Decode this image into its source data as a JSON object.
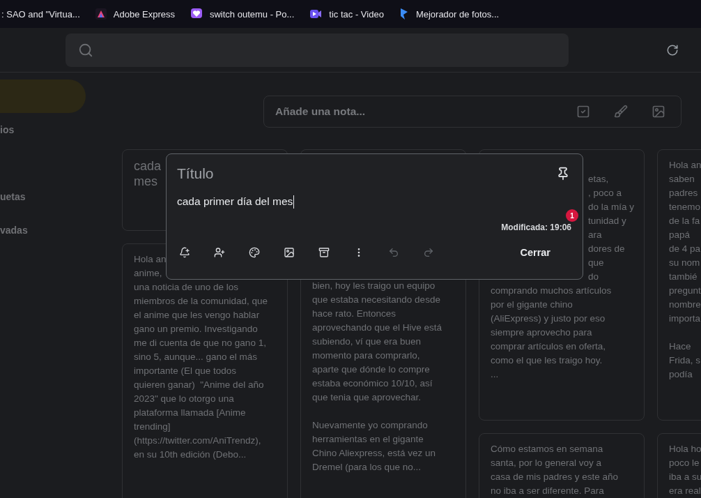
{
  "bookmarks": [
    {
      "label": ": SAO and \"Virtua...",
      "kind": "none"
    },
    {
      "label": "Adobe Express",
      "kind": "adobe"
    },
    {
      "label": "switch outemu - Po...",
      "kind": "heart"
    },
    {
      "label": "tic tac - Video",
      "kind": "video"
    },
    {
      "label": "Mejorador de fotos...",
      "kind": "spark"
    }
  ],
  "sidebar": {
    "items": [
      {
        "selected": true
      },
      {
        "label": "ios",
        "selected": false
      },
      {
        "label": "uetas",
        "selected": false
      },
      {
        "label": "vadas",
        "selected": false
      }
    ]
  },
  "take_note": {
    "placeholder": "Añade una nota..."
  },
  "columns": [
    {
      "notes": [
        {
          "kind": "title",
          "title": "cada\nmes"
        },
        {
          "kind": "body",
          "body": "Hola an\nanime,\nuna noticia de uno de los\nmiembros de la comunidad, que\nel anime que les vengo hablar\ngano un premio. Investigando\nme di cuenta de que no gano 1,\nsino 5, aunque... gano el más\nimportante (El que todos\nquieren ganar)  \"Anime del año\n2023\" que lo otorgo una\nplataforma llamada [Anime\ntrending]\n(https://twitter.com/AniTrendz),\nen su 10th edición (Debo..."
        }
      ]
    },
    {
      "notes": [
        {
          "kind": "continued",
          "body": "bien, hoy les traigo un equipo\nque estaba necesitando desde\nhace rato. Entonces\naprovechando que el Hive está\nsubiendo, ví que era buen\nmomento para comprarlo,\naparte que dónde lo compre\nestaba económico 10/10, así\nque tenia que aprovechar.\n\nNuevamente yo comprando\nherramientas en el gigante\nChino Aliexpress, está vez un\nDremel (para los que no..."
        }
      ]
    },
    {
      "notes": [
        {
          "kind": "tail",
          "tail": "etas,\n, poco a\ndo la mía y\ntunidad y\nara\ndores de\nque\ndo",
          "body": "comprando muchos artículos\npor el gigante chino\n(AliExpress) y justo por eso\nsiempre aprovecho para\ncomprar artículos en oferta,\ncomo el que les traigo hoy.\n..."
        },
        {
          "kind": "body",
          "body": "Cómo estamos en semana\nsanta, por lo general voy a\ncasa de mis padres y este año\nno iba a ser diferente. Para"
        }
      ]
    },
    {
      "notes": [
        {
          "kind": "body",
          "body": "Hola an\nsaben\npadres\ntenemo\nde la fa\npapá\nde 4 pa\nsu nom\ntambié\npregunt\nnombre\nimporta\n\nHace\nFrida, s\npodía"
        },
        {
          "kind": "body",
          "body": "Hola ho\npoco le\niba a su\nera real"
        }
      ]
    }
  ],
  "editor": {
    "title_placeholder": "Título",
    "text": "cada primer día del mes",
    "badge": "1",
    "modified": "Modificada: 19:06",
    "tools": [
      {
        "kind": "reminder",
        "disabled": false
      },
      {
        "kind": "collaborator",
        "disabled": false
      },
      {
        "kind": "palette",
        "disabled": false
      },
      {
        "kind": "image",
        "disabled": false
      },
      {
        "kind": "archive",
        "disabled": false
      },
      {
        "kind": "more",
        "disabled": false
      },
      {
        "kind": "undo",
        "disabled": true
      },
      {
        "kind": "redo",
        "disabled": true
      }
    ],
    "close": "Cerrar"
  }
}
